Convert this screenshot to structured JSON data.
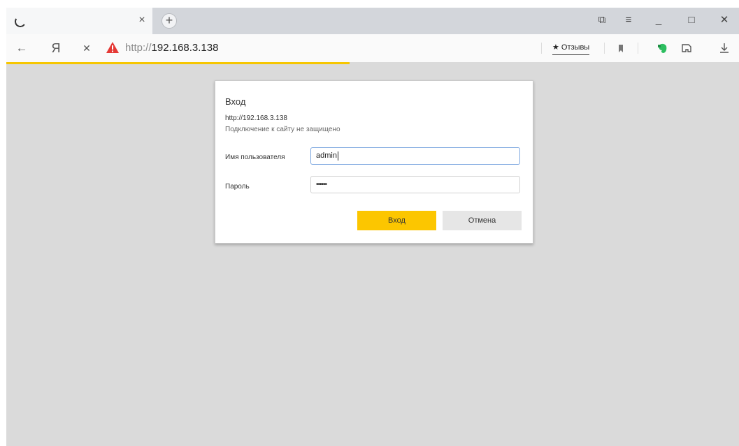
{
  "browser": {
    "tab": {
      "close_glyph": "×"
    },
    "new_tab_glyph": "+",
    "window_controls": {
      "tabs_glyph": "⧉",
      "menu_glyph": "≡",
      "minimize_glyph": "_",
      "maximize_glyph": "□",
      "close_glyph": "✕"
    },
    "nav": {
      "back_glyph": "←",
      "yandex_glyph": "Я",
      "stop_glyph": "✕"
    },
    "address": {
      "protocol": "http://",
      "host": "192.168.3.138"
    },
    "reviews_label": "★ Отзывы",
    "accent_color": "#f6c600"
  },
  "dialog": {
    "title": "Вход",
    "url": "http://192.168.3.138",
    "note": "Подключение к сайту не защищено",
    "username_label": "Имя пользователя",
    "username_value": "admin",
    "password_label": "Пароль",
    "password_value": "••••••",
    "ok_label": "Вход",
    "cancel_label": "Отмена"
  }
}
